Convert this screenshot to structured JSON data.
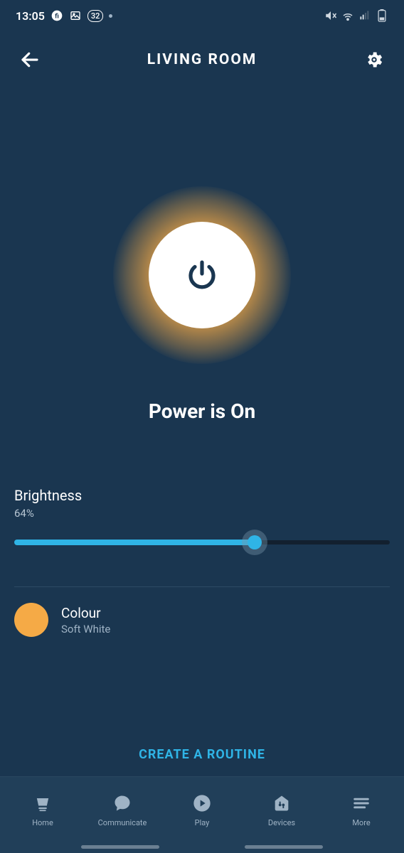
{
  "status": {
    "time": "13:05",
    "badge": "32"
  },
  "header": {
    "title": "LIVING ROOM"
  },
  "power": {
    "status_text": "Power is On",
    "glow_color": "#f5aa46"
  },
  "brightness": {
    "label": "Brightness",
    "value_text": "64%",
    "value_pct": 64
  },
  "colour": {
    "label": "Colour",
    "value": "Soft White",
    "swatch": "#f5aa46"
  },
  "routine": {
    "label": "CREATE A ROUTINE"
  },
  "nav": {
    "home": "Home",
    "communicate": "Communicate",
    "play": "Play",
    "devices": "Devices",
    "more": "More"
  },
  "colors": {
    "accent": "#2fb4e6",
    "bg": "#1a3650"
  }
}
